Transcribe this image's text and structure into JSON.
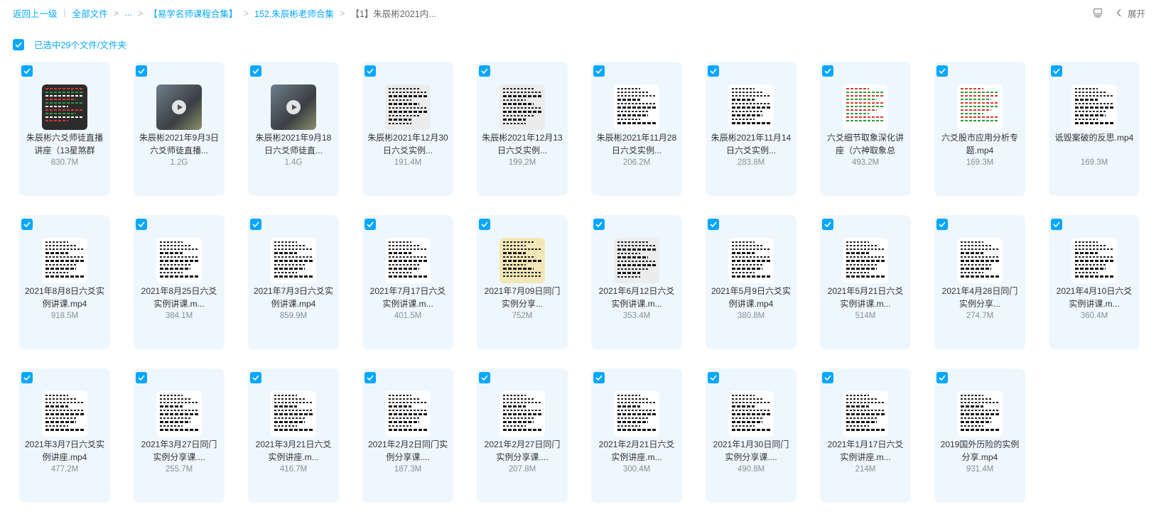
{
  "breadcrumb": {
    "back": "返回上一级",
    "all_files": "全部文件",
    "ellipsis": "...",
    "level1": "【易学名师课程合集】",
    "level2": "152.朱辰彬老师合集",
    "current": "【1】朱辰彬2021内..."
  },
  "toolbar": {
    "expand_label": "展开"
  },
  "selection": {
    "label": "已选中29个文件/文件夹"
  },
  "accent_color": "#06a7ff",
  "files": [
    {
      "name": "朱辰彬六爻师徒直播讲座（13星煞群",
      "size": "830.7M",
      "thumb": "dark",
      "icon": "chart-thumbnail"
    },
    {
      "name": "朱辰彬2021年9月3日六爻师徒直播...",
      "size": "1.2G",
      "thumb": "video",
      "icon": "video-thumbnail"
    },
    {
      "name": "朱辰彬2021年9月18日六爻师徒直...",
      "size": "1.4G",
      "thumb": "video",
      "icon": "video-thumbnail"
    },
    {
      "name": "朱辰彬2021年12月30日六爻实例...",
      "size": "191.4M",
      "thumb": "gray",
      "icon": "document-thumbnail"
    },
    {
      "name": "朱辰彬2021年12月13日六爻实例...",
      "size": "199.2M",
      "thumb": "gray",
      "icon": "document-thumbnail"
    },
    {
      "name": "朱辰彬2021年11月28日六爻实例...",
      "size": "206.2M",
      "thumb": "doc",
      "icon": "document-thumbnail"
    },
    {
      "name": "朱辰彬2021年11月14日六爻实例...",
      "size": "283.8M",
      "thumb": "doc",
      "icon": "document-thumbnail"
    },
    {
      "name": "六爻细节取象深化讲座（六神取象总",
      "size": "493.2M",
      "thumb": "color",
      "icon": "chart-thumbnail"
    },
    {
      "name": "六爻股市应用分析专题.mp4",
      "size": "169.3M",
      "thumb": "color",
      "icon": "chart-thumbnail"
    },
    {
      "name": "诋毁案破的反思.mp4",
      "size": "169.3M",
      "thumb": "doc",
      "icon": "document-thumbnail"
    },
    {
      "name": "2021年8月8日六爻实例讲课.mp4",
      "size": "918.5M",
      "thumb": "doc",
      "icon": "document-thumbnail"
    },
    {
      "name": "2021年8月25日六爻实例讲课.m...",
      "size": "384.1M",
      "thumb": "doc",
      "icon": "document-thumbnail"
    },
    {
      "name": "2021年7月3日六爻实例讲课.mp4",
      "size": "859.9M",
      "thumb": "doc",
      "icon": "document-thumbnail"
    },
    {
      "name": "2021年7月17日六爻实例讲课.m...",
      "size": "401.5M",
      "thumb": "doc",
      "icon": "document-thumbnail"
    },
    {
      "name": "2021年7月09日同门实例分享...",
      "size": "752M",
      "thumb": "cream",
      "icon": "document-thumbnail"
    },
    {
      "name": "2021年6月12日六爻实例讲课.m...",
      "size": "353.4M",
      "thumb": "gray",
      "icon": "document-thumbnail"
    },
    {
      "name": "2021年5月9日六爻实例讲课.mp4",
      "size": "380.8M",
      "thumb": "doc",
      "icon": "document-thumbnail"
    },
    {
      "name": "2021年5月21日六爻实例讲课.m...",
      "size": "514M",
      "thumb": "doc",
      "icon": "document-thumbnail"
    },
    {
      "name": "2021年4月28日同门实例分享...",
      "size": "274.7M",
      "thumb": "doc",
      "icon": "document-thumbnail"
    },
    {
      "name": "2021年4月10日六爻实例讲课.m...",
      "size": "360.4M",
      "thumb": "doc",
      "icon": "document-thumbnail"
    },
    {
      "name": "2021年3月7日六爻实例讲座.mp4",
      "size": "477.2M",
      "thumb": "doc",
      "icon": "document-thumbnail"
    },
    {
      "name": "2021年3月27日同门实例分享课....",
      "size": "255.7M",
      "thumb": "doc",
      "icon": "document-thumbnail"
    },
    {
      "name": "2021年3月21日六爻实例讲座.m...",
      "size": "416.7M",
      "thumb": "doc",
      "icon": "document-thumbnail"
    },
    {
      "name": "2021年2月2日同门实例分享课....",
      "size": "187.3M",
      "thumb": "doc",
      "icon": "document-thumbnail"
    },
    {
      "name": "2021年2月27日同门实例分享课....",
      "size": "207.8M",
      "thumb": "doc",
      "icon": "document-thumbnail"
    },
    {
      "name": "2021年2月21日六爻实例讲座.m...",
      "size": "300.4M",
      "thumb": "doc",
      "icon": "document-thumbnail"
    },
    {
      "name": "2021年1月30日同门实例分享课....",
      "size": "490.8M",
      "thumb": "doc",
      "icon": "document-thumbnail"
    },
    {
      "name": "2021年1月17日六爻实例讲座.m...",
      "size": "214M",
      "thumb": "doc",
      "icon": "document-thumbnail"
    },
    {
      "name": "2019国外历险的实例分享.mp4",
      "size": "931.4M",
      "thumb": "doc",
      "icon": "document-thumbnail"
    }
  ]
}
